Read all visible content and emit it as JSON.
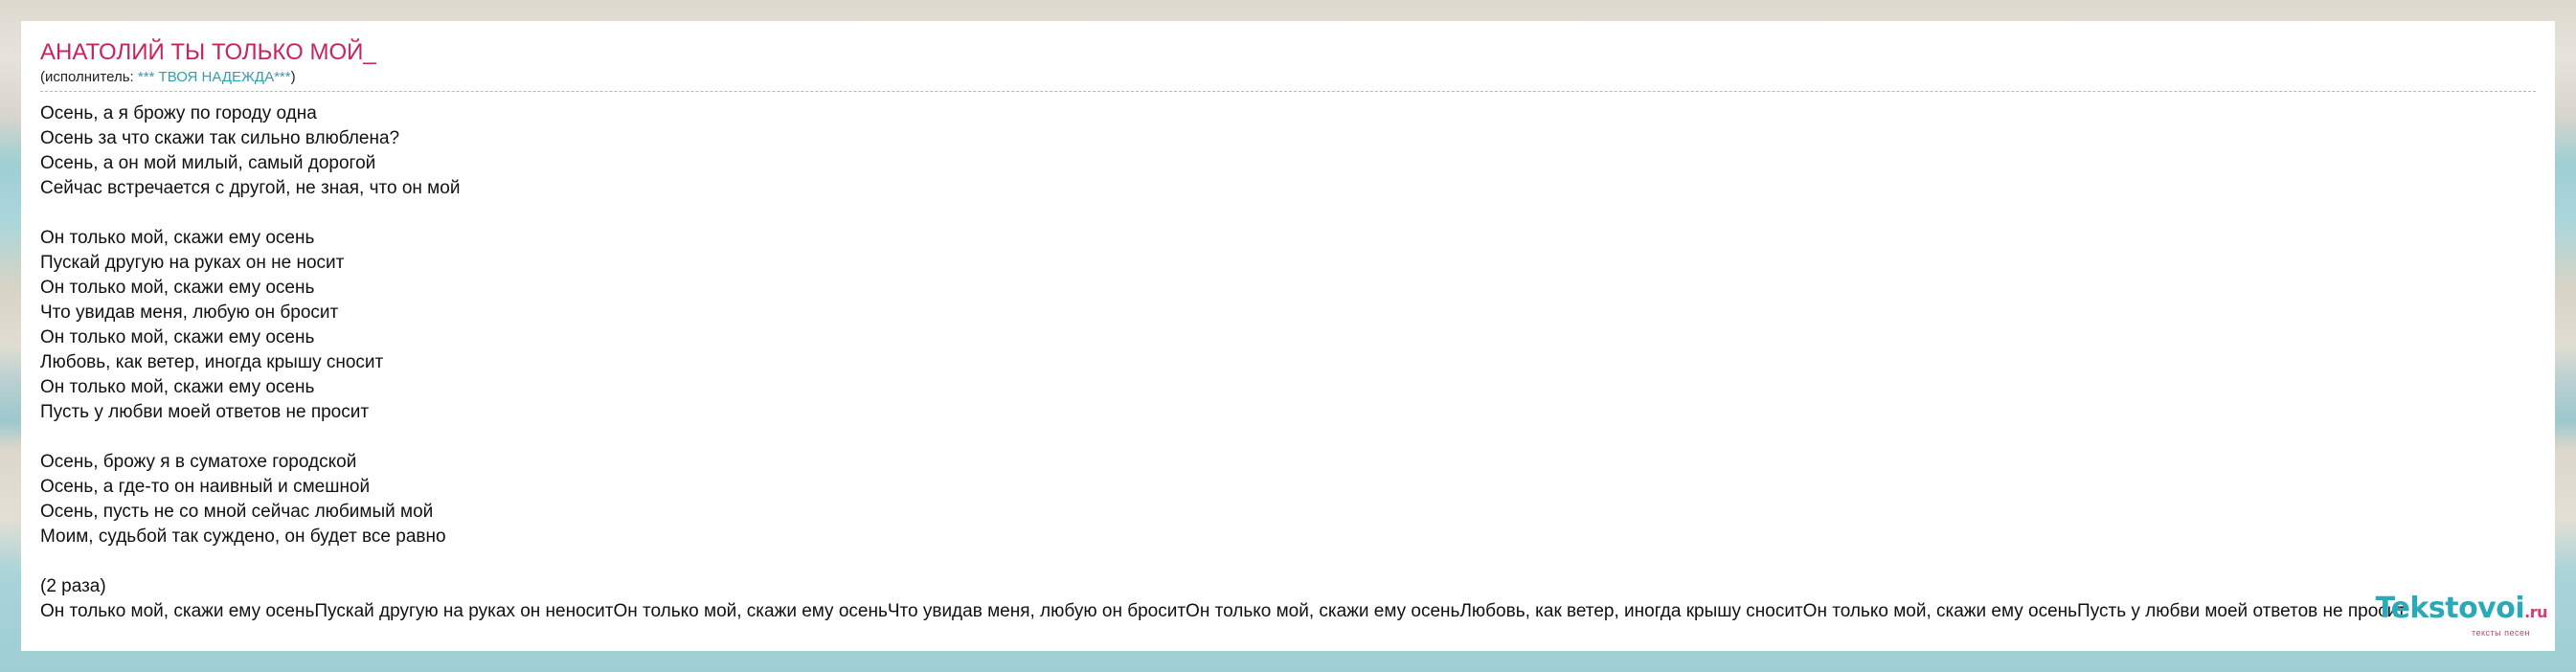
{
  "song": {
    "title": "АНАТОЛИЙ ТЫ ТОЛЬКО МОЙ_",
    "performer_prefix": "(исполнитель: ",
    "performer_name": "*** ТВОЯ НАДЕЖДА***",
    "performer_suffix": ")"
  },
  "lyrics": {
    "stanza1": [
      "Осень, а я брожу по городу одна",
      "Осень за что скажи так сильно влюблена?",
      "Осень, а он мой милый, самый дорогой",
      "Сейчас встречается с другой, не зная, что он мой"
    ],
    "stanza2": [
      "Он только мой, скажи ему осень",
      "Пускай другую на руках он не носит",
      "Он только мой, скажи ему осень",
      "Что увидав меня, любую он бросит",
      "Он только мой, скажи ему осень",
      "Любовь, как ветер, иногда крышу сносит",
      "Он только мой, скажи ему осень",
      "Пусть у любви моей ответов не просит"
    ],
    "stanza3": [
      "Осень, брожу я в суматохе городской",
      "Осень, а где-то он наивный и смешной",
      "Осень, пусть не со мной сейчас любимый мой",
      "Моим, судьбой так суждено, он будет все равно"
    ],
    "stanza4": [
      "(2 раза)",
      "Он только мой, скажи ему осеньПускай другую на руках он неноситОн только мой, скажи ему осеньЧто увидав меня, любую он броситОн только мой, скажи ему осеньЛюбовь, как ветер, иногда крышу сноситОн только мой, скажи ему осеньПусть у любви моей ответов не просит"
    ]
  },
  "logo": {
    "main": "Tekstovoi",
    "tld": ".ru",
    "tagline": "тексты песен"
  }
}
